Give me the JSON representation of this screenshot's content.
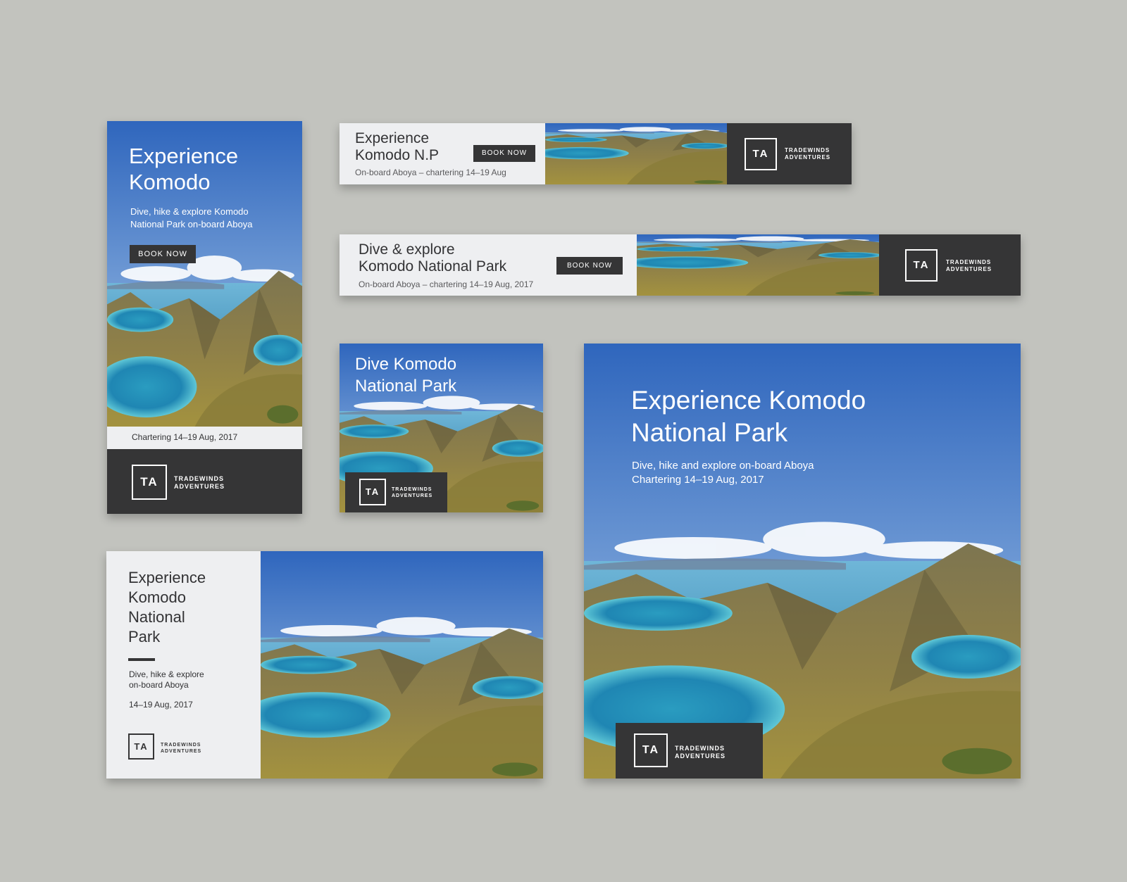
{
  "brand": {
    "monogram": "TA",
    "line1": "TRADEWINDS",
    "line2": "ADVENTURES"
  },
  "skyscraper": {
    "title_line1": "Experience",
    "title_line2": "Komodo",
    "body_line1": "Dive, hike & explore Komodo",
    "body_line2": "National Park on-board Aboya",
    "button": "BOOK NOW",
    "footer": "Chartering 14–19 Aug, 2017"
  },
  "leaderboard_small": {
    "title_line1": "Experience",
    "title_line2": "Komodo N.P",
    "button": "BOOK NOW",
    "subtitle": "On-board Aboya – chartering 14–19 Aug"
  },
  "leaderboard_large": {
    "title_line1": "Dive & explore",
    "title_line2": "Komodo National Park",
    "button": "BOOK NOW",
    "subtitle": "On-board Aboya – chartering 14–19 Aug, 2017"
  },
  "square": {
    "title_line1": "Dive Komodo",
    "title_line2": "National Park"
  },
  "large_square": {
    "title_line1": "Experience Komodo",
    "title_line2": "National Park",
    "body_line1": "Dive, hike and explore on-board Aboya",
    "body_line2": "Chartering 14–19 Aug, 2017"
  },
  "rectangle": {
    "title_line1": "Experience",
    "title_line2": "Komodo",
    "title_line3": "National",
    "title_line4": "Park",
    "body_line1": "Dive, hike & explore",
    "body_line2": "on-board Aboya",
    "date": "14–19 Aug, 2017"
  },
  "colors": {
    "background": "#c2c3be",
    "panel_dark": "#353536",
    "panel_light": "#eeeff1",
    "sky": "#3f78c6"
  }
}
